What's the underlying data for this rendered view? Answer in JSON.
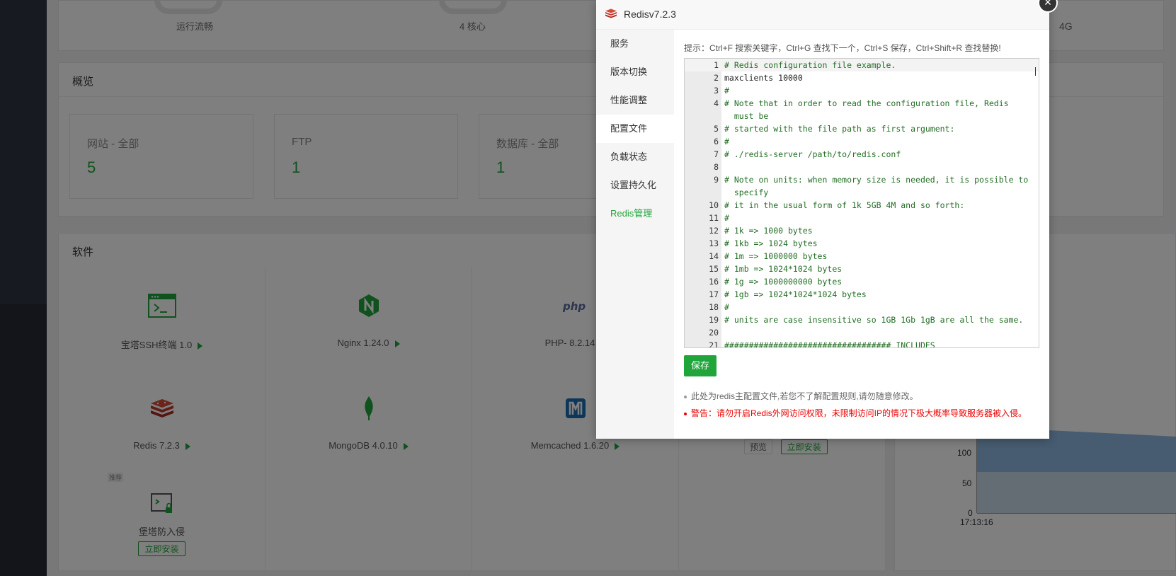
{
  "status": {
    "gauge1_label": "运行流畅",
    "gauge2_label": "4 核心",
    "gauge4_label": "4G"
  },
  "overview": {
    "title": "概览",
    "cards": [
      {
        "label": "网站 - 全部",
        "value": "5"
      },
      {
        "label": "FTP",
        "value": "1"
      },
      {
        "label": "数据库 - 全部",
        "value": "1"
      }
    ]
  },
  "software": {
    "title": "软件",
    "items": [
      {
        "name": "宝塔SSH终端 1.0",
        "icon": "terminal-icon"
      },
      {
        "name": "Nginx 1.24.0",
        "icon": "nginx-icon"
      },
      {
        "name": "PHP- 8.2.14",
        "icon": "php-icon"
      },
      {
        "name": "Redis 7.2.3",
        "icon": "redis-icon"
      },
      {
        "name": "MongoDB 4.0.10",
        "icon": "mongodb-icon"
      },
      {
        "name": "Memcached 1.6.20",
        "icon": "memcached-icon"
      },
      {
        "name": "堡塔防入侵",
        "icon": "intrusion-icon"
      }
    ],
    "tag": "推荐",
    "install_label": "立即安装",
    "preview_label": "预览"
  },
  "chart": {
    "y_ticks": [
      "100",
      "50",
      "0"
    ],
    "x_tick": "17:13:16"
  },
  "modal": {
    "title": "Redisv7.2.3",
    "close": "×",
    "sidebar": [
      {
        "label": "服务"
      },
      {
        "label": "版本切换"
      },
      {
        "label": "性能调整"
      },
      {
        "label": "配置文件"
      },
      {
        "label": "负载状态"
      },
      {
        "label": "设置持久化"
      },
      {
        "label": "Redis管理"
      }
    ],
    "active_index": 3,
    "tip": "提示：Ctrl+F 搜索关键字，Ctrl+G 查找下一个，Ctrl+S 保存，Ctrl+Shift+R 查找替换!",
    "lines": [
      {
        "n": "1",
        "t": "# Redis configuration file example."
      },
      {
        "n": "2",
        "t": "maxclients 10000"
      },
      {
        "n": "3",
        "t": "#"
      },
      {
        "n": "4",
        "t": "# Note that in order to read the configuration file, Redis"
      },
      {
        "n": "",
        "t": "  must be"
      },
      {
        "n": "5",
        "t": "# started with the file path as first argument:"
      },
      {
        "n": "6",
        "t": "#"
      },
      {
        "n": "7",
        "t": "# ./redis-server /path/to/redis.conf"
      },
      {
        "n": "8",
        "t": ""
      },
      {
        "n": "9",
        "t": "# Note on units: when memory size is needed, it is possible to"
      },
      {
        "n": "",
        "t": "  specify"
      },
      {
        "n": "10",
        "t": "# it in the usual form of 1k 5GB 4M and so forth:"
      },
      {
        "n": "11",
        "t": "#"
      },
      {
        "n": "12",
        "t": "# 1k => 1000 bytes"
      },
      {
        "n": "13",
        "t": "# 1kb => 1024 bytes"
      },
      {
        "n": "14",
        "t": "# 1m => 1000000 bytes"
      },
      {
        "n": "15",
        "t": "# 1mb => 1024*1024 bytes"
      },
      {
        "n": "16",
        "t": "# 1g => 1000000000 bytes"
      },
      {
        "n": "17",
        "t": "# 1gb => 1024*1024*1024 bytes"
      },
      {
        "n": "18",
        "t": "#"
      },
      {
        "n": "19",
        "t": "# units are case insensitive so 1GB 1Gb 1gB are all the same."
      },
      {
        "n": "20",
        "t": ""
      },
      {
        "n": "21",
        "t": "################################## INCLUDES"
      }
    ],
    "save_label": "保存",
    "note_gray": "此处为redis主配置文件,若您不了解配置规则,请勿随意修改。",
    "note_red": "警告：请勿开启Redis外网访问权限，未限制访问IP的情况下极大概率导致服务器被入侵。"
  }
}
